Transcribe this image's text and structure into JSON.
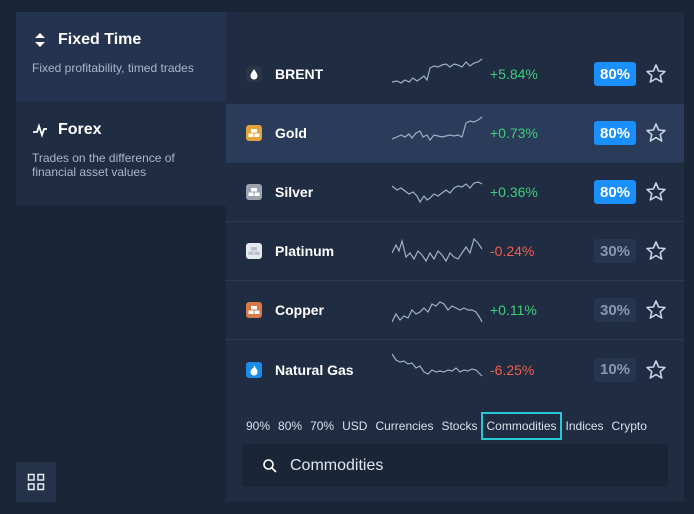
{
  "modes": [
    {
      "title": "Fixed Time",
      "subtitle": "Fixed profitability, timed trades"
    },
    {
      "title": "Forex",
      "subtitle": "Trades on the difference of financial asset values"
    }
  ],
  "assets": [
    {
      "name": "BRENT",
      "change": "+5.84%",
      "payout": "80%",
      "icon_color": "#2a3548",
      "icon": "drop-icon"
    },
    {
      "name": "Gold",
      "change": "+0.73%",
      "payout": "80%",
      "icon_color": "#e0a43a",
      "icon": "gold-bars-icon"
    },
    {
      "name": "Silver",
      "change": "+0.36%",
      "payout": "80%",
      "icon_color": "#9aa3b0",
      "icon": "silver-bars-icon"
    },
    {
      "name": "Platinum",
      "change": "-0.24%",
      "payout": "30%",
      "icon_color": "#e6e9ee",
      "icon": "platinum-bars-icon"
    },
    {
      "name": "Copper",
      "change": "+0.11%",
      "payout": "30%",
      "icon_color": "#d9794a",
      "icon": "copper-bars-icon"
    },
    {
      "name": "Natural Gas",
      "change": "-6.25%",
      "payout": "10%",
      "icon_color": "#1b8de8",
      "icon": "flame-icon"
    }
  ],
  "filters": [
    "90%",
    "80%",
    "70%",
    "USD",
    "Currencies",
    "Stocks",
    "Commodities",
    "Indices",
    "Crypto"
  ],
  "active_filter": "Commodities",
  "search": {
    "value": "Commodities"
  }
}
